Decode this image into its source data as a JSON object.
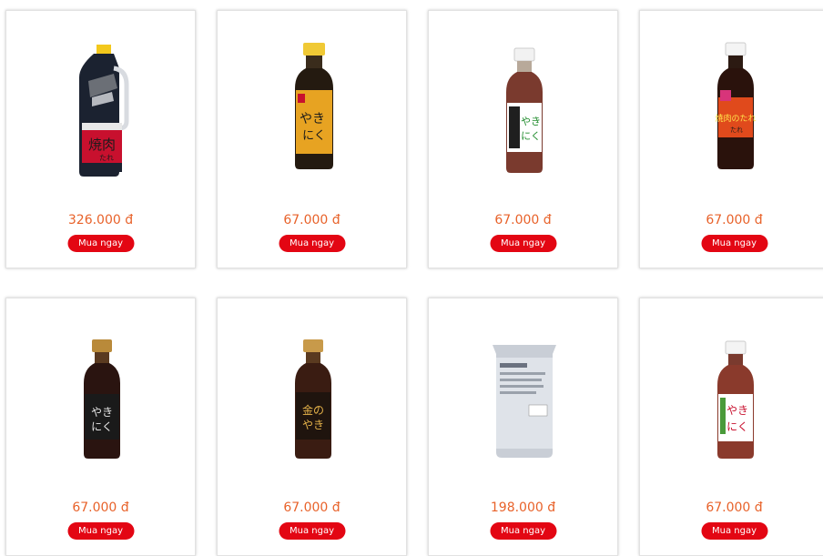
{
  "products": [
    {
      "price": "326.000 đ",
      "buy_label": "Mua ngay",
      "image": "yakiniku-tare-jug-bottle"
    },
    {
      "price": "67.000 đ",
      "buy_label": "Mua ngay",
      "image": "yakiniku-yellow-label-bottle"
    },
    {
      "price": "67.000 đ",
      "buy_label": "Mua ngay",
      "image": "yakiniku-green-label-bottle"
    },
    {
      "price": "67.000 đ",
      "buy_label": "Mua ngay",
      "image": "yakiniku-orange-label-bottle"
    },
    {
      "price": "67.000 đ",
      "buy_label": "Mua ngay",
      "image": "yakiniku-black-label-bottle"
    },
    {
      "price": "67.000 đ",
      "buy_label": "Mua ngay",
      "image": "yakiniku-gold-label-bottle"
    },
    {
      "price": "198.000 đ",
      "buy_label": "Mua ngay",
      "image": "sauce-refill-pouch"
    },
    {
      "price": "67.000 đ",
      "buy_label": "Mua ngay",
      "image": "yakiniku-white-label-bottle"
    }
  ],
  "colors": {
    "price": "#e8622a",
    "button": "#e30613"
  }
}
